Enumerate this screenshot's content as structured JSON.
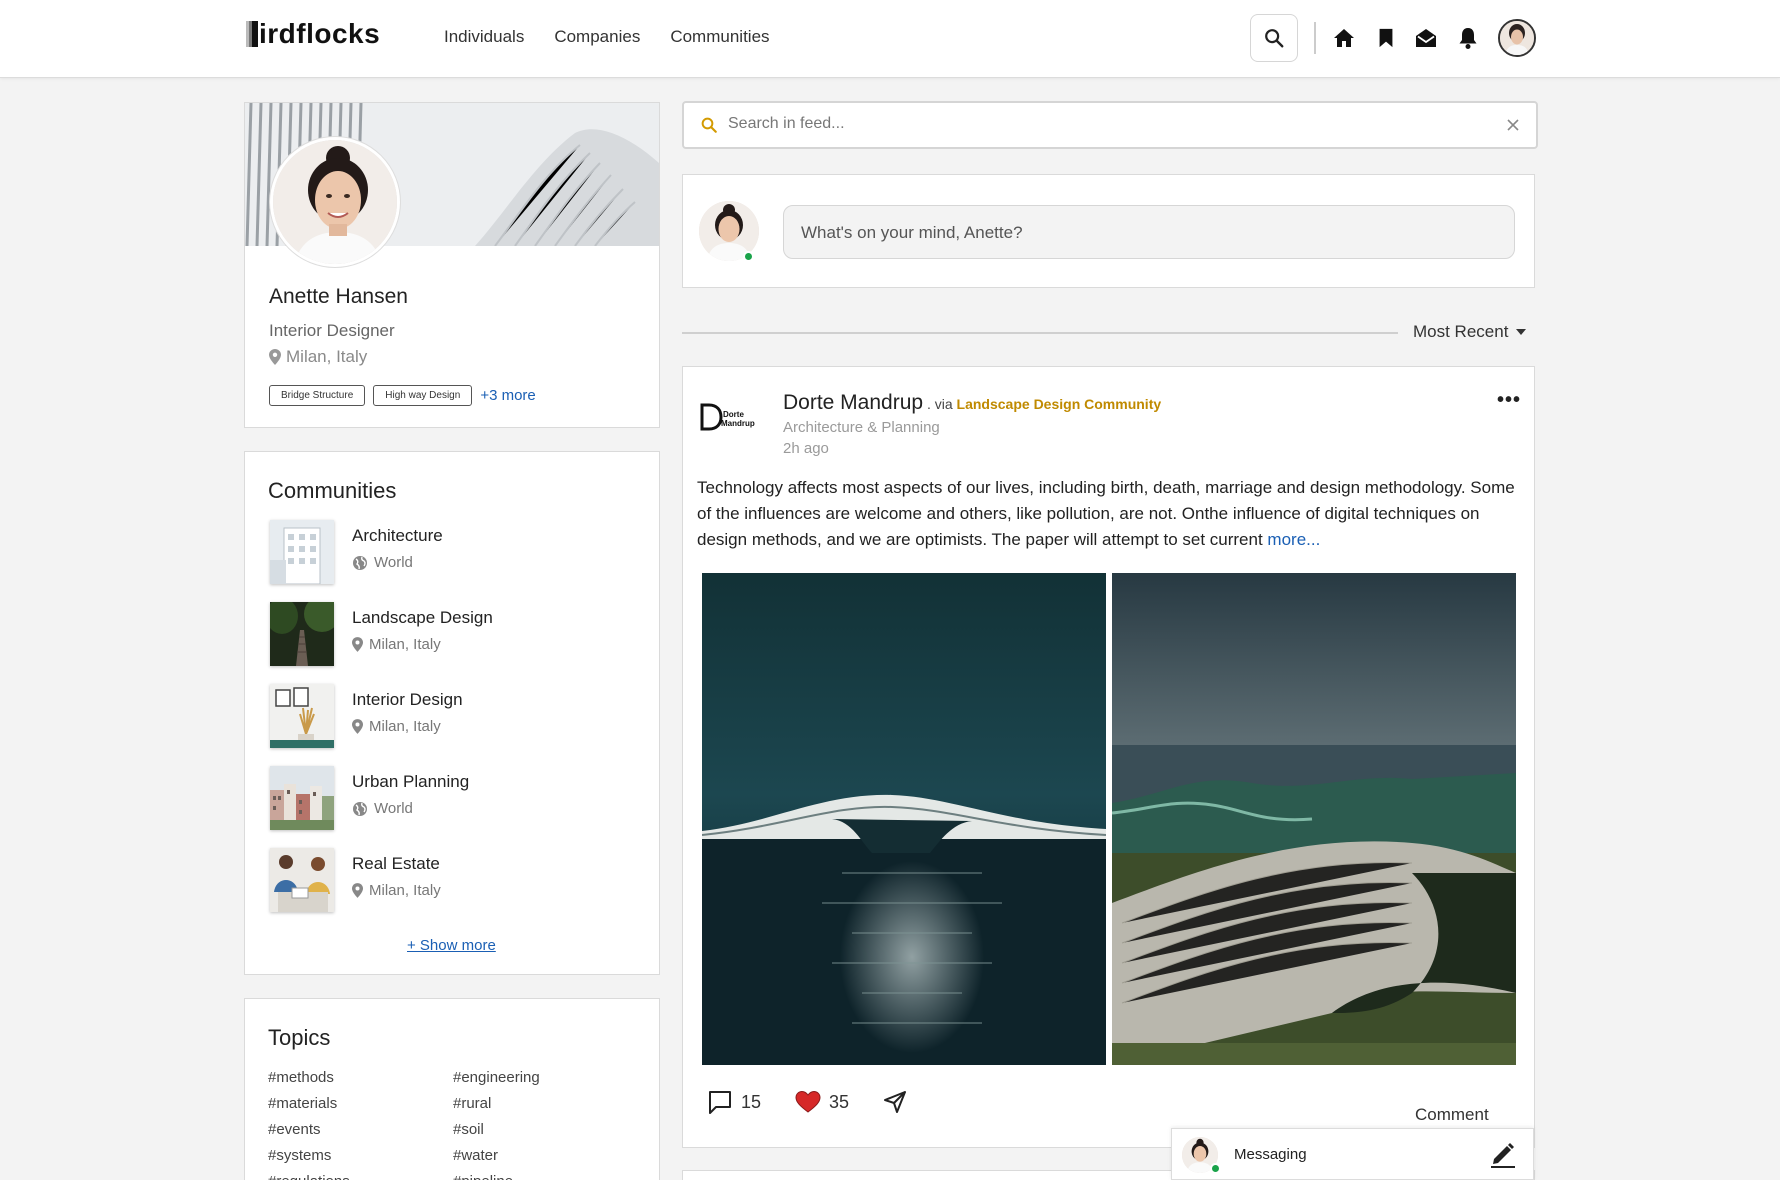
{
  "app": {
    "brand": "irdflocks",
    "nav": [
      "Individuals",
      "Companies",
      "Communities"
    ]
  },
  "profile": {
    "name": "Anette Hansen",
    "title": "Interior Designer",
    "location": "Milan, Italy",
    "tags": [
      "Bridge Structure",
      "High way Design"
    ],
    "more_tags": "+3 more"
  },
  "communities": {
    "heading": "Communities",
    "items": [
      {
        "name": "Architecture",
        "location": "World",
        "icon": "globe-icon"
      },
      {
        "name": "Landscape Design",
        "location": "Milan, Italy",
        "icon": "pin-icon"
      },
      {
        "name": "Interior Design",
        "location": "Milan, Italy",
        "icon": "pin-icon"
      },
      {
        "name": "Urban Planning",
        "location": "World",
        "icon": "globe-icon"
      },
      {
        "name": "Real Estate",
        "location": "Milan, Italy",
        "icon": "pin-icon"
      }
    ],
    "show_more": "+ Show more"
  },
  "topics": {
    "heading": "Topics",
    "col1": [
      "#methods",
      "#materials",
      "#events",
      "#systems",
      "#regulations"
    ],
    "col2": [
      "#engineering",
      "#rural",
      "#soil",
      "#water",
      "#pipeline"
    ]
  },
  "feed": {
    "search_placeholder": "Search in feed...",
    "composer_placeholder": "What's on your mind, Anette?",
    "sort_label": "Most Recent"
  },
  "post": {
    "logo_text_1": "Dorte",
    "logo_text_2": "Mandrup",
    "author": "Dorte Mandrup",
    "via": " . via ",
    "community": "Landscape Design Community",
    "subtitle": "Architecture & Planning",
    "time": "2h ago",
    "text": "Technology affects most aspects of our lives, including birth, death, marriage and design methodology. Some of the influences are welcome and others, like pollution, are not. Onthe influence of digital techniques on design methods, and we are optimists. The paper will attempt to set current ",
    "more": "more...",
    "comments_count": "15",
    "likes_count": "35",
    "comment_label": "Comment"
  },
  "messaging": {
    "label": "Messaging"
  },
  "colors": {
    "link": "#1a5fb4",
    "community_accent": "#c08a00",
    "online": "#1aa34a",
    "like": "#d62828"
  }
}
